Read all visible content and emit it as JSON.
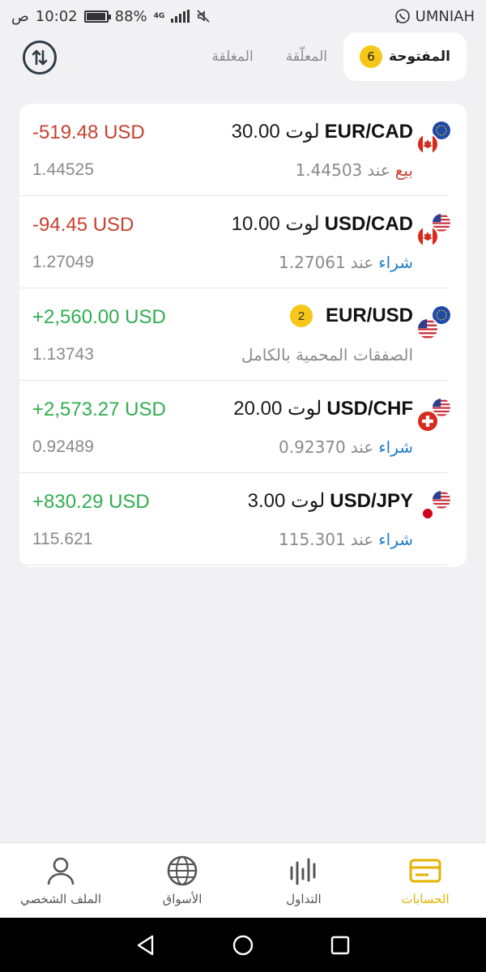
{
  "status_bar": {
    "carrier": "UMNIAH",
    "time": "10:02",
    "period": "ص",
    "battery": "88%",
    "battery_level": 0.88,
    "network": "4G"
  },
  "header": {
    "tabs": [
      {
        "label": "المفتوحة",
        "count": "6",
        "active": true
      },
      {
        "label": "المعلّقة",
        "active": false
      },
      {
        "label": "المغلقة",
        "active": false
      }
    ]
  },
  "positions": [
    {
      "symbol": "EUR/CAD",
      "lots": "30.00 لوت",
      "side": "بيع",
      "side_type": "sell",
      "at": "عند",
      "open_price": "1.44503",
      "pnl": "-519.48 USD",
      "pnl_type": "neg",
      "current_price": "1.44525",
      "flags": [
        "eu-flag-icon",
        "canada-flag-icon"
      ]
    },
    {
      "symbol": "USD/CAD",
      "lots": "10.00 لوت",
      "side": "شراء",
      "side_type": "buy",
      "at": "عند",
      "open_price": "1.27061",
      "pnl": "-94.45 USD",
      "pnl_type": "neg",
      "current_price": "1.27049",
      "flags": [
        "us-flag-icon",
        "canada-flag-icon"
      ]
    },
    {
      "symbol": "EUR/USD",
      "badge": "2",
      "protected_label": "الصفقات المحمية بالكامل",
      "pnl": "+2,560.00 USD",
      "pnl_type": "pos",
      "current_price": "1.13743",
      "flags": [
        "eu-flag-icon",
        "us-flag-icon"
      ]
    },
    {
      "symbol": "USD/CHF",
      "lots": "20.00 لوت",
      "side": "شراء",
      "side_type": "buy",
      "at": "عند",
      "open_price": "0.92370",
      "pnl": "+2,573.27 USD",
      "pnl_type": "pos",
      "current_price": "0.92489",
      "flags": [
        "us-flag-icon",
        "swiss-flag-icon"
      ]
    },
    {
      "symbol": "USD/JPY",
      "lots": "3.00 لوت",
      "side": "شراء",
      "side_type": "buy",
      "at": "عند",
      "open_price": "115.301",
      "pnl": "+830.29 USD",
      "pnl_type": "pos",
      "current_price": "115.621",
      "flags": [
        "us-flag-icon",
        "japan-flag-icon"
      ]
    }
  ],
  "bottom_nav": [
    {
      "label": "الملف الشخصي",
      "icon": "person-icon",
      "active": false
    },
    {
      "label": "الأسواق",
      "icon": "globe-icon",
      "active": false
    },
    {
      "label": "التداول",
      "icon": "chart-bars-icon",
      "active": false
    },
    {
      "label": "الحسابات",
      "icon": "wallet-card-icon",
      "active": true
    }
  ],
  "colors": {
    "accent": "#f6c719",
    "negative": "#c8402f",
    "positive": "#2fae4f",
    "buy": "#1f7ec8"
  }
}
